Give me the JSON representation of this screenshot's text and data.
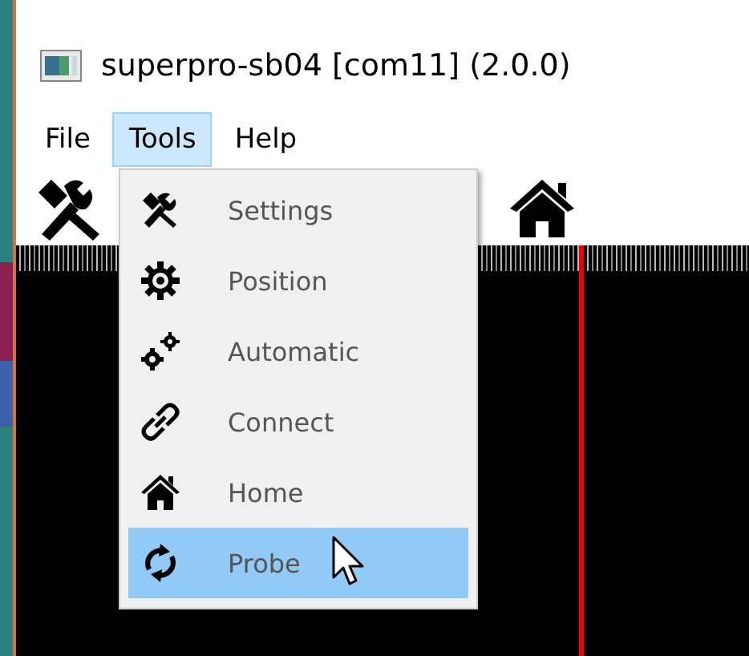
{
  "window": {
    "title": "superpro-sb04 [com11] (2.0.0)"
  },
  "menu_bar": [
    {
      "label": "File",
      "selected": false
    },
    {
      "label": "Tools",
      "selected": true
    },
    {
      "label": "Help",
      "selected": false
    }
  ],
  "tools_menu": [
    {
      "label": "Settings",
      "selected": false
    },
    {
      "label": "Position",
      "selected": false
    },
    {
      "label": "Automatic",
      "selected": false
    },
    {
      "label": "Connect",
      "selected": false
    },
    {
      "label": "Home",
      "selected": false
    },
    {
      "label": "Probe",
      "selected": true
    }
  ]
}
